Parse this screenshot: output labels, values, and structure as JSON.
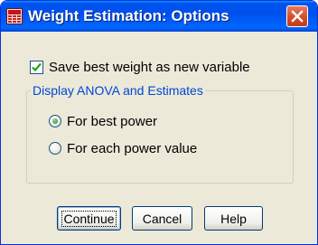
{
  "window": {
    "title": "Weight Estimation: Options",
    "app_icon": "table-grid-icon",
    "close_icon": "close-icon"
  },
  "options": {
    "save_best_weight": {
      "label": "Save best weight as new variable",
      "checked": true
    },
    "display_group": {
      "legend": "Display ANOVA and Estimates",
      "selected": "For best power",
      "choices": [
        {
          "label": "For best power",
          "selected": true
        },
        {
          "label": "For each power value",
          "selected": false
        }
      ]
    }
  },
  "buttons": {
    "continue": "Continue",
    "cancel": "Cancel",
    "help": "Help"
  },
  "colors": {
    "title_bar": "#0053ee",
    "close_button": "#d24a26",
    "group_legend_text": "#0046d5",
    "dialog_background": "#ece9d8"
  }
}
